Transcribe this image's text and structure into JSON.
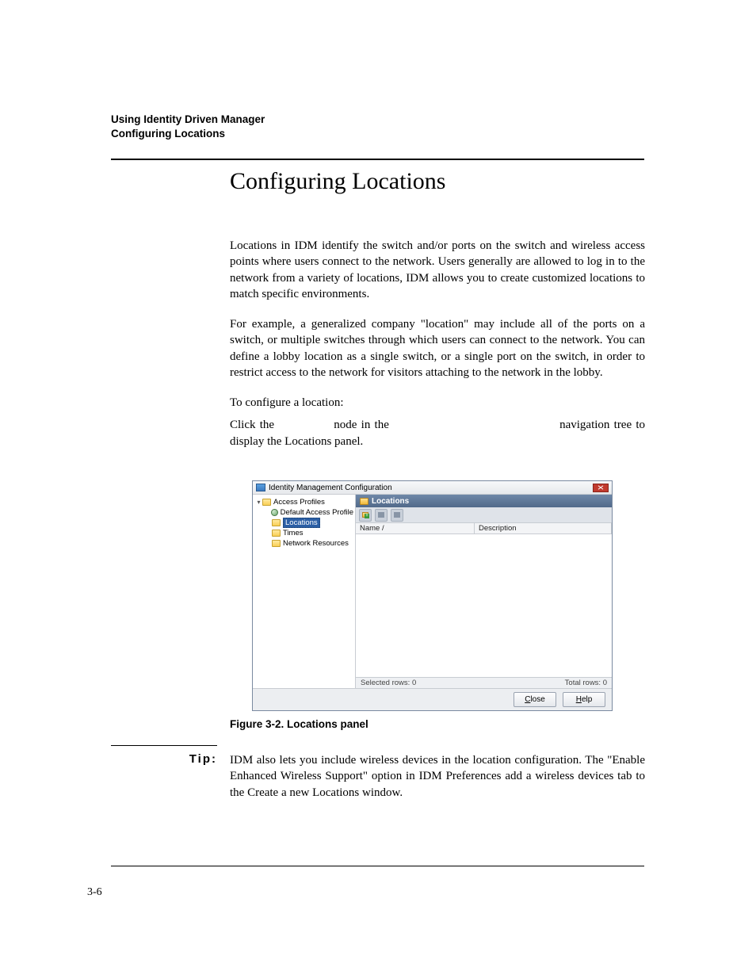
{
  "runningHead": {
    "line1": "Using Identity Driven Manager",
    "line2": "Configuring Locations"
  },
  "heading": "Configuring Locations",
  "para1": "Locations in IDM identify the switch and/or ports on the switch and wireless access points where users connect to the network. Users generally are allowed to log in to the network from a variety of locations, IDM allows you to create customized locations to match specific environments.",
  "para2": "For example, a generalized company \"location\" may include all of the ports on a switch, or multiple switches through which users can connect to the network. You can define a lobby location as a single switch, or a single port on the switch, in order to restrict access to the network for visitors attaching to the network in the lobby.",
  "para3": "To configure a location:",
  "para4a": "Click the",
  "para4b": "node in the",
  "para4c": "navigation tree to display the Locations panel.",
  "screenshot": {
    "title": "Identity Management Configuration",
    "tree": {
      "root": "Access Profiles",
      "defaultProfile": "Default Access Profile",
      "locations": "Locations",
      "times": "Times",
      "networkResources": "Network Resources"
    },
    "panelTitle": "Locations",
    "columns": {
      "name": "Name  /",
      "description": "Description"
    },
    "status": {
      "selected": "Selected rows: 0",
      "total": "Total rows: 0"
    },
    "buttons": {
      "close": "Close",
      "closeMn": "C",
      "help": "Help",
      "helpMn": "H"
    }
  },
  "figCaption": "Figure 3-2. Locations panel",
  "tipLabel": "Tip:",
  "tipBody": "IDM also lets you include wireless devices in the location configuration. The \"Enable Enhanced Wireless Support\" option in IDM Preferences add a wireless devices tab to the Create a new Locations window.",
  "pageNumber": "3-6"
}
